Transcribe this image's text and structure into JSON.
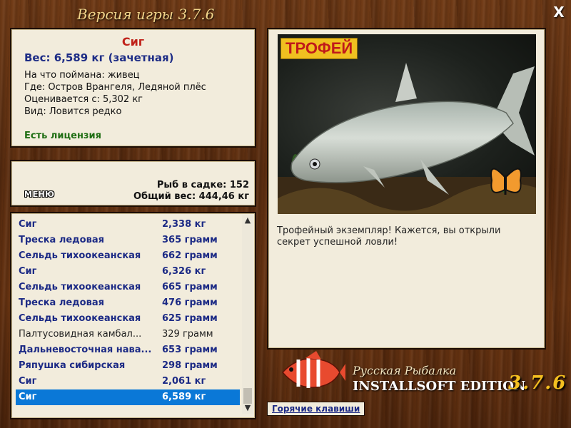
{
  "window": {
    "title": "Версия игры 3.7.6",
    "close_label": "X"
  },
  "catch_info": {
    "name": "Сиг",
    "weight": "Вес: 6,589 кг (зачетная)",
    "lines": [
      "На что поймана: живец",
      "Где: Остров Врангеля, Ледяной плёс",
      "Оценивается с: 5,302 кг",
      "Вид: Ловится редко"
    ],
    "license": "Есть лицензия"
  },
  "stats": {
    "menu_label": "МЕНЮ",
    "fish_count": "Рыб в садке: 152",
    "total_weight": "Общий вес: 444,46 кг"
  },
  "catch_list": [
    {
      "name": "Сиг",
      "weight": "2,338 кг",
      "style": "bold"
    },
    {
      "name": "Треска ледовая",
      "weight": "365 грамм",
      "style": "bold"
    },
    {
      "name": "Сельдь тихоокеанская",
      "weight": "662 грамм",
      "style": "bold"
    },
    {
      "name": "Сиг",
      "weight": "6,326 кг",
      "style": "bold"
    },
    {
      "name": "Сельдь тихоокеанская",
      "weight": "665 грамм",
      "style": "bold"
    },
    {
      "name": "Треска ледовая",
      "weight": "476 грамм",
      "style": "bold"
    },
    {
      "name": "Сельдь тихоокеанская",
      "weight": "625 грамм",
      "style": "bold"
    },
    {
      "name": "Палтусовидная камбал...",
      "weight": "329 грамм",
      "style": "normal"
    },
    {
      "name": "Дальневосточная нава...",
      "weight": "653 грамм",
      "style": "bold"
    },
    {
      "name": "Ряпушка сибирская",
      "weight": "298 грамм",
      "style": "bold"
    },
    {
      "name": "Сиг",
      "weight": "2,061 кг",
      "style": "bold"
    },
    {
      "name": "Сиг",
      "weight": "6,589 кг",
      "style": "selected"
    }
  ],
  "photo": {
    "trophy_label": "ТРОФЕЙ",
    "message": "Трофейный экземпляр! Кажется, вы открыли секрет успешной ловли!"
  },
  "branding": {
    "line1": "Русская Рыбалка",
    "line2": "INSTALLSOFT EDITION",
    "version": "3.7.6"
  },
  "hotkeys_label": "Горячие клавиши",
  "colors": {
    "selected_row": "#0a78d7",
    "name_red": "#c0221a",
    "weight_blue": "#1e2d86",
    "license_green": "#1f6e13",
    "trophy_bg": "#f0c020"
  }
}
